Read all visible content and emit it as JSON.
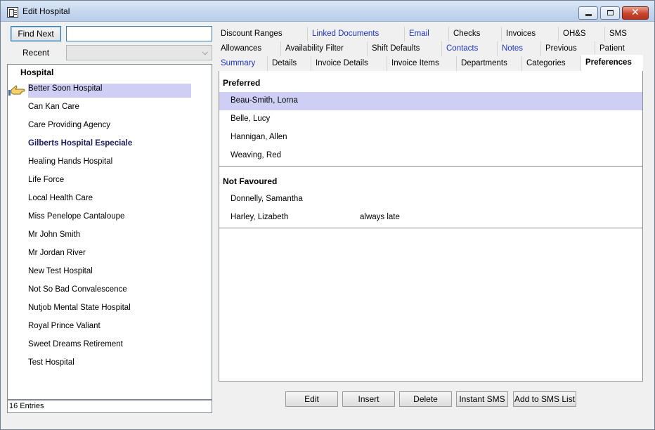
{
  "window": {
    "title": "Edit Hospital"
  },
  "search": {
    "find_next_label": "Find Next",
    "value": "",
    "recent_label": "Recent",
    "recent_value": ""
  },
  "list": {
    "header": "Hospital",
    "items": [
      "Better Soon Hospital",
      "Can Kan Care",
      "Care Providing Agency",
      "Gilberts Hospital Especiale",
      "Healing Hands Hospital",
      "Life Force",
      "Local Health Care",
      "Miss Penelope Cantaloupe",
      "Mr John Smith",
      "Mr Jordan River",
      "New Test Hospital",
      "Not So Bad Convalescence",
      "Nutjob Mental State Hospital",
      "Royal Prince Valiant",
      "Sweet Dreams Retirement",
      "Test Hospital"
    ],
    "status": "16 Entries"
  },
  "tabs": {
    "row1": [
      "Discount Ranges",
      "Linked Documents",
      "Email",
      "Checks",
      "Invoices",
      "OH&S",
      "SMS"
    ],
    "row2": [
      "Allowances",
      "Availability Filter",
      "Shift Defaults",
      "Contacts",
      "Notes",
      "Previous",
      "Patient"
    ],
    "row3": [
      "Summary",
      "Details",
      "Invoice Details",
      "Invoice Items",
      "Departments",
      "Categories",
      "Preferences"
    ]
  },
  "preferences": {
    "preferred_title": "Preferred",
    "preferred": [
      {
        "name": "Beau-Smith, Lorna",
        "note": ""
      },
      {
        "name": "Belle, Lucy",
        "note": ""
      },
      {
        "name": "Hannigan, Allen",
        "note": ""
      },
      {
        "name": "Weaving, Red",
        "note": ""
      }
    ],
    "not_favoured_title": "Not Favoured",
    "not_favoured": [
      {
        "name": "Donnelly, Samantha",
        "note": ""
      },
      {
        "name": "Harley, Lizabeth",
        "note": "always late"
      }
    ]
  },
  "actions": {
    "edit": "Edit",
    "insert": "Insert",
    "delete": "Delete",
    "instant_sms": "Instant SMS",
    "add_to_sms_list": "Add to SMS List"
  },
  "colors": {
    "selection": "#cfcff6",
    "link": "#1d34c4",
    "bold_item": "#1b1b60"
  }
}
